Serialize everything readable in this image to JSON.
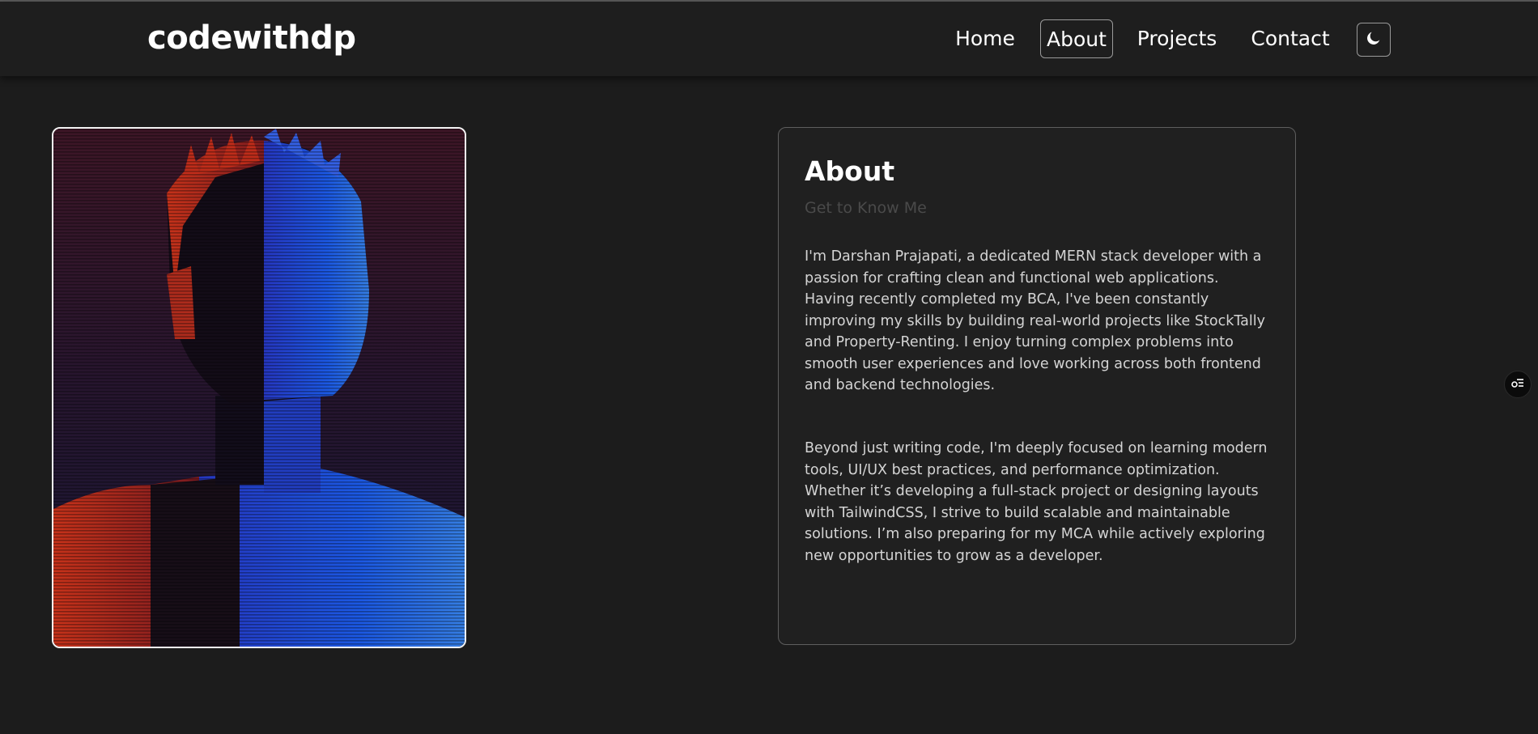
{
  "header": {
    "brand": "codewithdp",
    "nav": [
      {
        "label": "Home",
        "active": false
      },
      {
        "label": "About",
        "active": true
      },
      {
        "label": "Projects",
        "active": false
      },
      {
        "label": "Contact",
        "active": false
      }
    ],
    "theme_toggle_icon": "moon-icon"
  },
  "about": {
    "title": "About",
    "subtitle": "Get to Know Me",
    "paragraph1": "I'm Darshan Prajapati, a dedicated MERN stack developer with a passion for crafting clean and functional web applications. Having recently completed my BCA, I've been constantly improving my skills by building real-world projects like StockTally and Property-Renting. I enjoy turning complex problems into smooth user experiences and love working across both frontend and backend technologies.",
    "paragraph2": "Beyond just writing code, I'm deeply focused on learning modern tools, UI/UX best practices, and performance optimization. Whether it’s developing a full-stack project or designing layouts with TailwindCSS, I strive to build scalable and maintainable solutions. I’m also preparing for my MCA while actively exploring new opportunities to grow as a developer."
  },
  "profile_image": {
    "icon": "glitch-portrait-image"
  },
  "floating_button": {
    "icon": "settings-list-icon"
  },
  "colors": {
    "background": "#1c1c1c",
    "navbar": "#1e1e1e",
    "card": "#202020",
    "portrait_red": "#d8321c",
    "portrait_blue": "#1e5cff"
  }
}
